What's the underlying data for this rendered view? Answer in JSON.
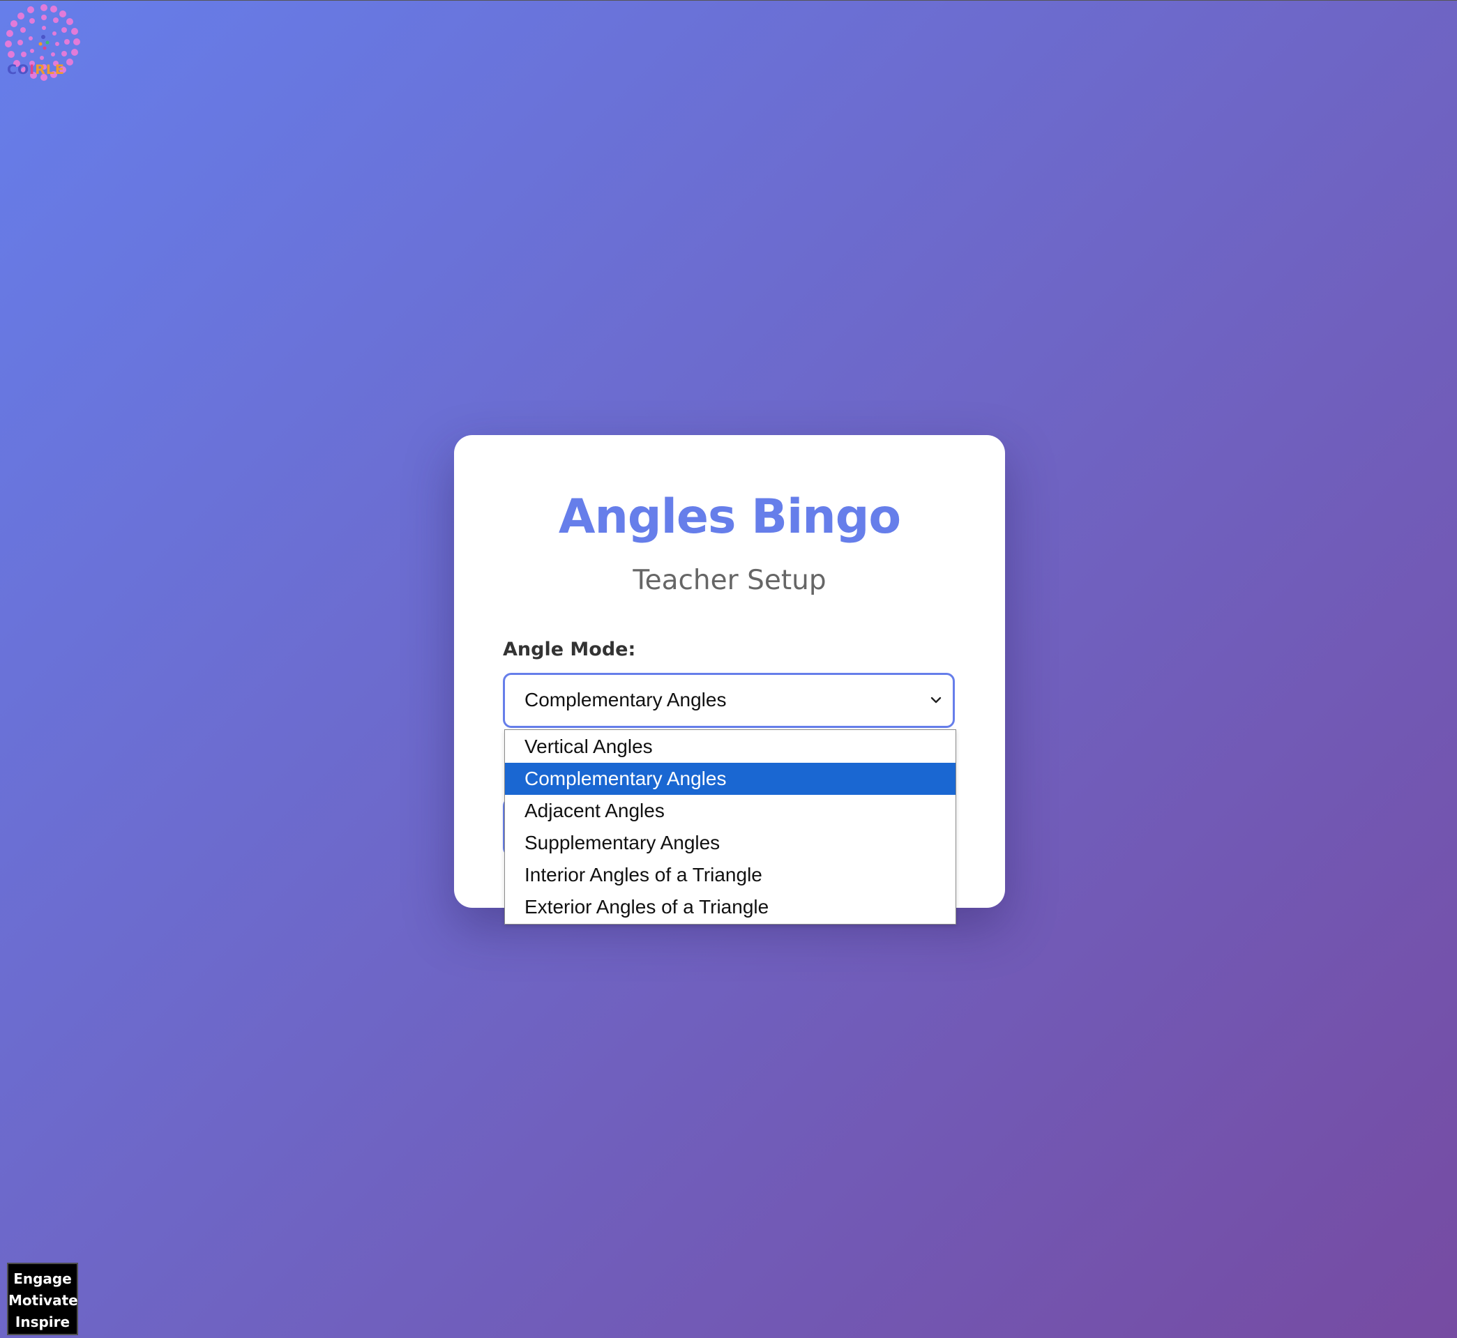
{
  "logo": {
    "text_part1": "CO",
    "text_part2": "I",
    "text_part3": "RLE"
  },
  "setup": {
    "title": "Angles Bingo",
    "subtitle": "Teacher Setup",
    "mode_label": "Angle Mode:",
    "selected_value": "Complementary Angles"
  },
  "dropdown": {
    "options": [
      "Vertical Angles",
      "Complementary Angles",
      "Adjacent Angles",
      "Supplementary Angles",
      "Interior Angles of a Triangle",
      "Exterior Angles of a Triangle"
    ],
    "highlighted_index": 1
  },
  "tagline": {
    "line1": "Engage",
    "line2": "Motivate",
    "line3": "Inspire"
  },
  "colors": {
    "accent": "#667eea",
    "highlight": "#1a67d2",
    "background_start": "#667eea",
    "background_end": "#764ba2"
  }
}
